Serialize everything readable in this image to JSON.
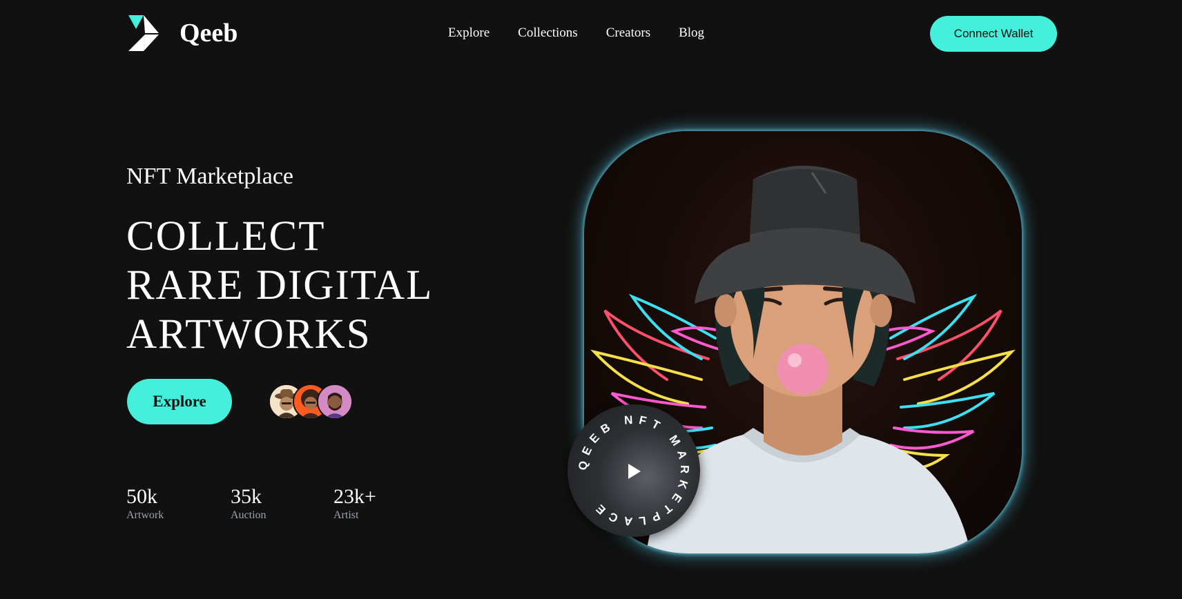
{
  "brand": {
    "name": "Qeeb",
    "accent": "#44f0db"
  },
  "nav": {
    "items": [
      "Explore",
      "Collections",
      "Creators",
      "Blog"
    ]
  },
  "header": {
    "connect_label": "Connect Wallet"
  },
  "hero": {
    "eyebrow": "NFT Marketplace",
    "headline": [
      "COLLECT",
      "RARE DIGITAL",
      "ARTWORKS"
    ],
    "cta_label": "Explore",
    "avatars": [
      "cowboy-avatar",
      "curly-hair-avatar",
      "bearded-avatar"
    ],
    "stats": [
      {
        "value": "50k",
        "label": "Artwork"
      },
      {
        "value": "35k",
        "label": "Auction"
      },
      {
        "value": "23k+",
        "label": "Artist"
      }
    ],
    "badge_text": "QEEB NFT MARKETPLACE",
    "badge_icon": "play-icon"
  }
}
